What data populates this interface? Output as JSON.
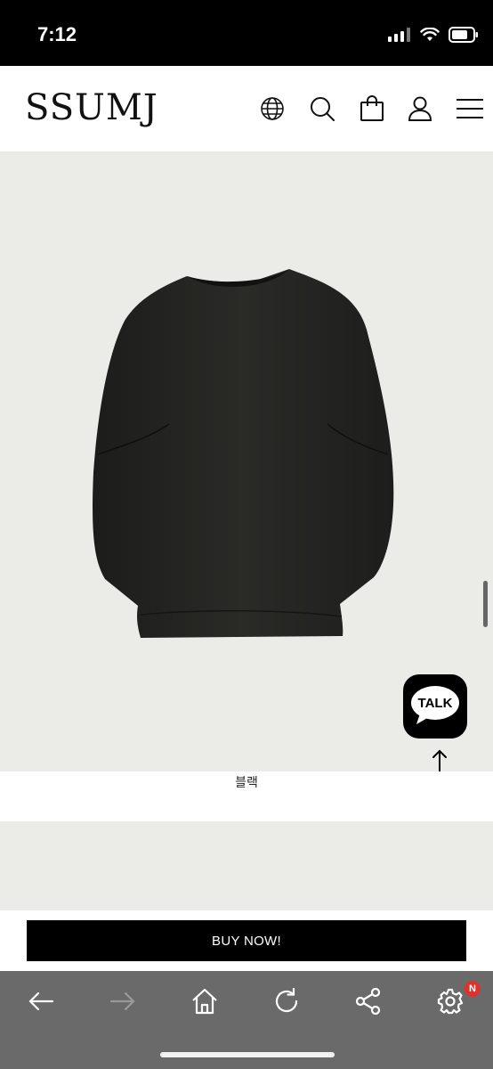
{
  "status_bar": {
    "time": "7:12"
  },
  "header": {
    "logo": "SSUMJ",
    "icons": [
      "globe-icon",
      "search-icon",
      "shopping-bag-icon",
      "user-icon",
      "menu-icon"
    ]
  },
  "product": {
    "image": "black-oversized-top",
    "color_label": "블랙"
  },
  "chat": {
    "talk_label": "TALK"
  },
  "buy_button": {
    "label": "BUY NOW!"
  },
  "toolbar": {
    "buttons": [
      "back-icon",
      "forward-icon",
      "home-icon",
      "reload-icon",
      "share-icon",
      "settings-icon"
    ],
    "badge": "N"
  },
  "colors": {
    "brand": "#000000",
    "toolbar": "#6a6a6a",
    "badge": "#e0322d",
    "product_bg": "#ebebe7"
  }
}
